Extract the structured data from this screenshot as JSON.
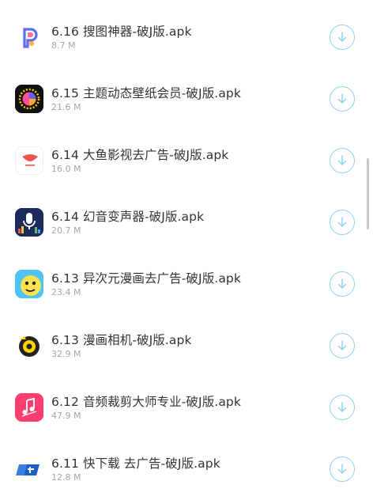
{
  "files": [
    {
      "title": "6.16 搜图神器-破J版.apk",
      "size": "8.7 M",
      "icon": "sotu-app-icon"
    },
    {
      "title": "6.15 主题动态壁纸会员-破J版.apk",
      "size": "21.6 M",
      "icon": "wallpaper-app-icon"
    },
    {
      "title": "6.14 大鱼影视去广告-破J版.apk",
      "size": "16.0 M",
      "icon": "dayu-app-icon"
    },
    {
      "title": "6.14 幻音变声器-破J版.apk",
      "size": "20.7 M",
      "icon": "voice-changer-app-icon"
    },
    {
      "title": "6.13 异次元漫画去广告-破J版.apk",
      "size": "23.4 M",
      "icon": "comic-app-icon"
    },
    {
      "title": "6.13 漫画相机-破J版.apk",
      "size": "32.9 M",
      "icon": "comic-camera-app-icon"
    },
    {
      "title": "6.12 音频裁剪大师专业-破J版.apk",
      "size": "47.9 M",
      "icon": "audio-cutter-app-icon"
    },
    {
      "title": "6.11 快下载 去广告-破J版.apk",
      "size": "12.8 M",
      "icon": "quick-download-app-icon"
    }
  ],
  "colors": {
    "title": "#333333",
    "size": "#a6a6a6",
    "download_accent": "#8fd4f5"
  }
}
